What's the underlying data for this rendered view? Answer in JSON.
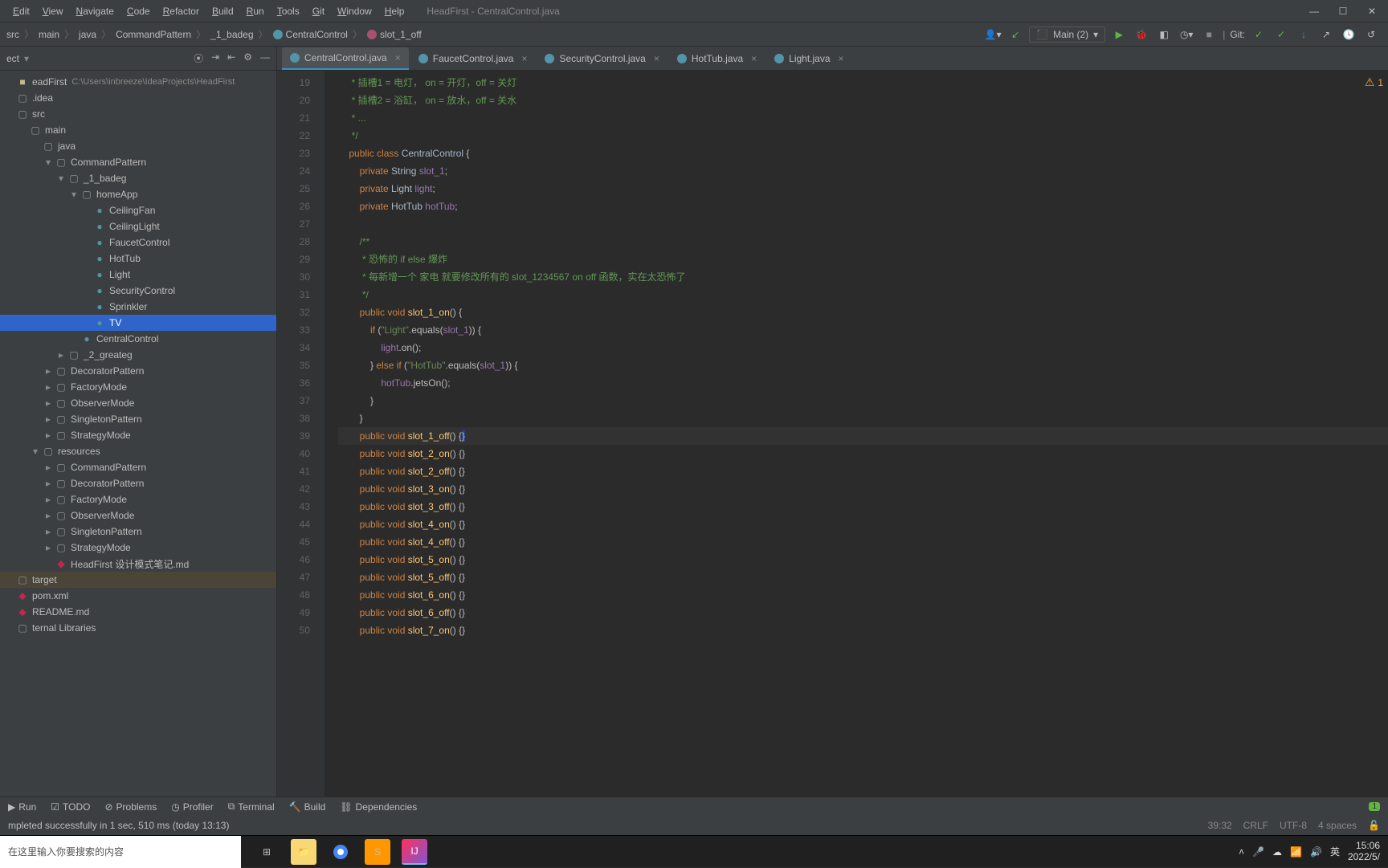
{
  "menubar": {
    "items": [
      "Edit",
      "View",
      "Navigate",
      "Code",
      "Refactor",
      "Build",
      "Run",
      "Tools",
      "Git",
      "Window",
      "Help"
    ],
    "title": "HeadFirst - CentralControl.java"
  },
  "breadcrumbs": [
    "src",
    "main",
    "java",
    "CommandPattern",
    "_1_badeg",
    "CentralControl",
    "slot_1_off"
  ],
  "run_config": "Main (2)",
  "git_label": "Git:",
  "sidebar": {
    "header": "ect",
    "proj": "eadFirst",
    "proj_path": "C:\\Users\\inbreeze\\IdeaProjects\\HeadFirst"
  },
  "tree": [
    {
      "d": 0,
      "a": "",
      "ic": "proj",
      "t": "eadFirst",
      "sub": "C:\\Users\\inbreeze\\IdeaProjects\\HeadFirst"
    },
    {
      "d": 0,
      "a": "",
      "ic": "dir",
      "t": ".idea"
    },
    {
      "d": 0,
      "a": "",
      "ic": "mod",
      "t": "src"
    },
    {
      "d": 1,
      "a": "",
      "ic": "mod",
      "t": "main"
    },
    {
      "d": 2,
      "a": "",
      "ic": "mod",
      "t": "java"
    },
    {
      "d": 3,
      "a": "v",
      "ic": "pkg",
      "t": "CommandPattern"
    },
    {
      "d": 4,
      "a": "v",
      "ic": "pkg",
      "t": "_1_badeg"
    },
    {
      "d": 5,
      "a": "v",
      "ic": "pkg",
      "t": "homeApp"
    },
    {
      "d": 6,
      "a": "",
      "ic": "cls",
      "t": "CeilingFan"
    },
    {
      "d": 6,
      "a": "",
      "ic": "cls",
      "t": "CeilingLight"
    },
    {
      "d": 6,
      "a": "",
      "ic": "cls",
      "t": "FaucetControl"
    },
    {
      "d": 6,
      "a": "",
      "ic": "cls",
      "t": "HotTub"
    },
    {
      "d": 6,
      "a": "",
      "ic": "cls",
      "t": "Light"
    },
    {
      "d": 6,
      "a": "",
      "ic": "cls",
      "t": "SecurityControl"
    },
    {
      "d": 6,
      "a": "",
      "ic": "cls",
      "t": "Sprinkler"
    },
    {
      "d": 6,
      "a": "",
      "ic": "cls",
      "t": "TV",
      "sel": true
    },
    {
      "d": 5,
      "a": "",
      "ic": "cls",
      "t": "CentralControl"
    },
    {
      "d": 4,
      "a": ">",
      "ic": "pkg",
      "t": "_2_greateg"
    },
    {
      "d": 3,
      "a": ">",
      "ic": "pkg",
      "t": "DecoratorPattern"
    },
    {
      "d": 3,
      "a": ">",
      "ic": "pkg",
      "t": "FactoryMode"
    },
    {
      "d": 3,
      "a": ">",
      "ic": "pkg",
      "t": "ObserverMode"
    },
    {
      "d": 3,
      "a": ">",
      "ic": "pkg",
      "t": "SingletonPattern"
    },
    {
      "d": 3,
      "a": ">",
      "ic": "pkg",
      "t": "StrategyMode"
    },
    {
      "d": 2,
      "a": "v",
      "ic": "mod",
      "t": "resources"
    },
    {
      "d": 3,
      "a": ">",
      "ic": "pkg",
      "t": "CommandPattern"
    },
    {
      "d": 3,
      "a": ">",
      "ic": "pkg",
      "t": "DecoratorPattern"
    },
    {
      "d": 3,
      "a": ">",
      "ic": "pkg",
      "t": "FactoryMode"
    },
    {
      "d": 3,
      "a": ">",
      "ic": "pkg",
      "t": "ObserverMode"
    },
    {
      "d": 3,
      "a": ">",
      "ic": "pkg",
      "t": "SingletonPattern"
    },
    {
      "d": 3,
      "a": ">",
      "ic": "pkg",
      "t": "StrategyMode"
    },
    {
      "d": 3,
      "a": "",
      "ic": "md",
      "t": "HeadFirst 设计模式笔记.md"
    },
    {
      "d": 0,
      "a": "",
      "ic": "dir",
      "t": "target",
      "tgt": true
    },
    {
      "d": 0,
      "a": "",
      "ic": "md",
      "t": "pom.xml"
    },
    {
      "d": 0,
      "a": "",
      "ic": "md",
      "t": "README.md"
    },
    {
      "d": 0,
      "a": "",
      "ic": "dir",
      "t": "ternal Libraries"
    }
  ],
  "tabs": [
    {
      "t": "CentralControl.java",
      "active": true
    },
    {
      "t": "FaucetControl.java"
    },
    {
      "t": "SecurityControl.java"
    },
    {
      "t": "HotTub.java"
    },
    {
      "t": "Light.java"
    }
  ],
  "lines_start": 19,
  "lines_end": 50,
  "code": [
    {
      "n": 19,
      "h": "     <span class='c'>* 插槽1 = 电灯， on = 开灯，off = 关灯</span>"
    },
    {
      "n": 20,
      "h": "     <span class='c'>* 插槽2 = 浴缸， on = 放水，off = 关水</span>"
    },
    {
      "n": 21,
      "h": "     <span class='c'>* ...</span>"
    },
    {
      "n": 22,
      "h": "     <span class='c'>*/</span>"
    },
    {
      "n": 23,
      "h": "    <span class='k'>public class</span> <span class='ty'>CentralControl</span> {"
    },
    {
      "n": 24,
      "h": "        <span class='k'>private</span> <span class='ty'>String</span> <span class='fld'>slot_1</span>;"
    },
    {
      "n": 25,
      "h": "        <span class='k'>private</span> <span class='ty'>Light</span> <span class='fld'>light</span>;"
    },
    {
      "n": 26,
      "h": "        <span class='k'>private</span> <span class='ty'>HotTub</span> <span class='fld'>hotTub</span>;"
    },
    {
      "n": 27,
      "h": ""
    },
    {
      "n": 28,
      "h": "        <span class='c'>/**</span>"
    },
    {
      "n": 29,
      "h": "         <span class='c'>* 恐怖的 if else 爆炸</span>"
    },
    {
      "n": 30,
      "h": "         <span class='c'>* 每新增一个 家电 就要修改所有的 slot_1234567 on off 函数，实在太恐怖了</span>"
    },
    {
      "n": 31,
      "h": "         <span class='c'>*/</span>"
    },
    {
      "n": 32,
      "h": "        <span class='k'>public void</span> <span class='fn'>slot_1_on</span>() {"
    },
    {
      "n": 33,
      "h": "            <span class='k'>if</span> (<span class='s'>\"Light\"</span>.equals(<span class='fld'>slot_1</span>)) {"
    },
    {
      "n": 34,
      "h": "                <span class='fld'>light</span>.on();"
    },
    {
      "n": 35,
      "h": "            } <span class='k'>else if</span> (<span class='s'>\"HotTub\"</span>.equals(<span class='fld'>slot_1</span>)) {"
    },
    {
      "n": 36,
      "h": "                <span class='fld'>hotTub</span>.jetsOn();"
    },
    {
      "n": 37,
      "h": "            }"
    },
    {
      "n": 38,
      "h": "        }"
    },
    {
      "n": 39,
      "h": "        <span class='k'>public void</span> <span class='fn'>slot_1_off</span>() {<span style='background:#214283'>}</span>",
      "cur": true
    },
    {
      "n": 40,
      "h": "        <span class='k'>public void</span> <span class='fn'>slot_2_on</span>() {}"
    },
    {
      "n": 41,
      "h": "        <span class='k'>public void</span> <span class='fn'>slot_2_off</span>() {}"
    },
    {
      "n": 42,
      "h": "        <span class='k'>public void</span> <span class='fn'>slot_3_on</span>() {}"
    },
    {
      "n": 43,
      "h": "        <span class='k'>public void</span> <span class='fn'>slot_3_off</span>() {}"
    },
    {
      "n": 44,
      "h": "        <span class='k'>public void</span> <span class='fn'>slot_4_on</span>() {}"
    },
    {
      "n": 45,
      "h": "        <span class='k'>public void</span> <span class='fn'>slot_4_off</span>() {}"
    },
    {
      "n": 46,
      "h": "        <span class='k'>public void</span> <span class='fn'>slot_5_on</span>() {}"
    },
    {
      "n": 47,
      "h": "        <span class='k'>public void</span> <span class='fn'>slot_5_off</span>() {}"
    },
    {
      "n": 48,
      "h": "        <span class='k'>public void</span> <span class='fn'>slot_6_on</span>() {}"
    },
    {
      "n": 49,
      "h": "        <span class='k'>public void</span> <span class='fn'>slot_6_off</span>() {}"
    },
    {
      "n": 50,
      "h": "        <span class='k'>public void</span> <span class='fn'>slot_7_on</span>() {}"
    }
  ],
  "warn_count": "1",
  "tool_tabs": [
    "Run",
    "TODO",
    "Problems",
    "Profiler",
    "Terminal",
    "Build",
    "Dependencies"
  ],
  "tool_badge": "1",
  "status_msg": "mpleted successfully in 1 sec, 510 ms (today 13:13)",
  "status_pos": "39:32",
  "status_sep": "CRLF",
  "status_enc": "UTF-8",
  "status_indent": "4 spaces",
  "search_placeholder": "在这里输入你要搜索的内容",
  "clock_time": "15:06",
  "clock_date": "2022/5/",
  "ime": "英"
}
